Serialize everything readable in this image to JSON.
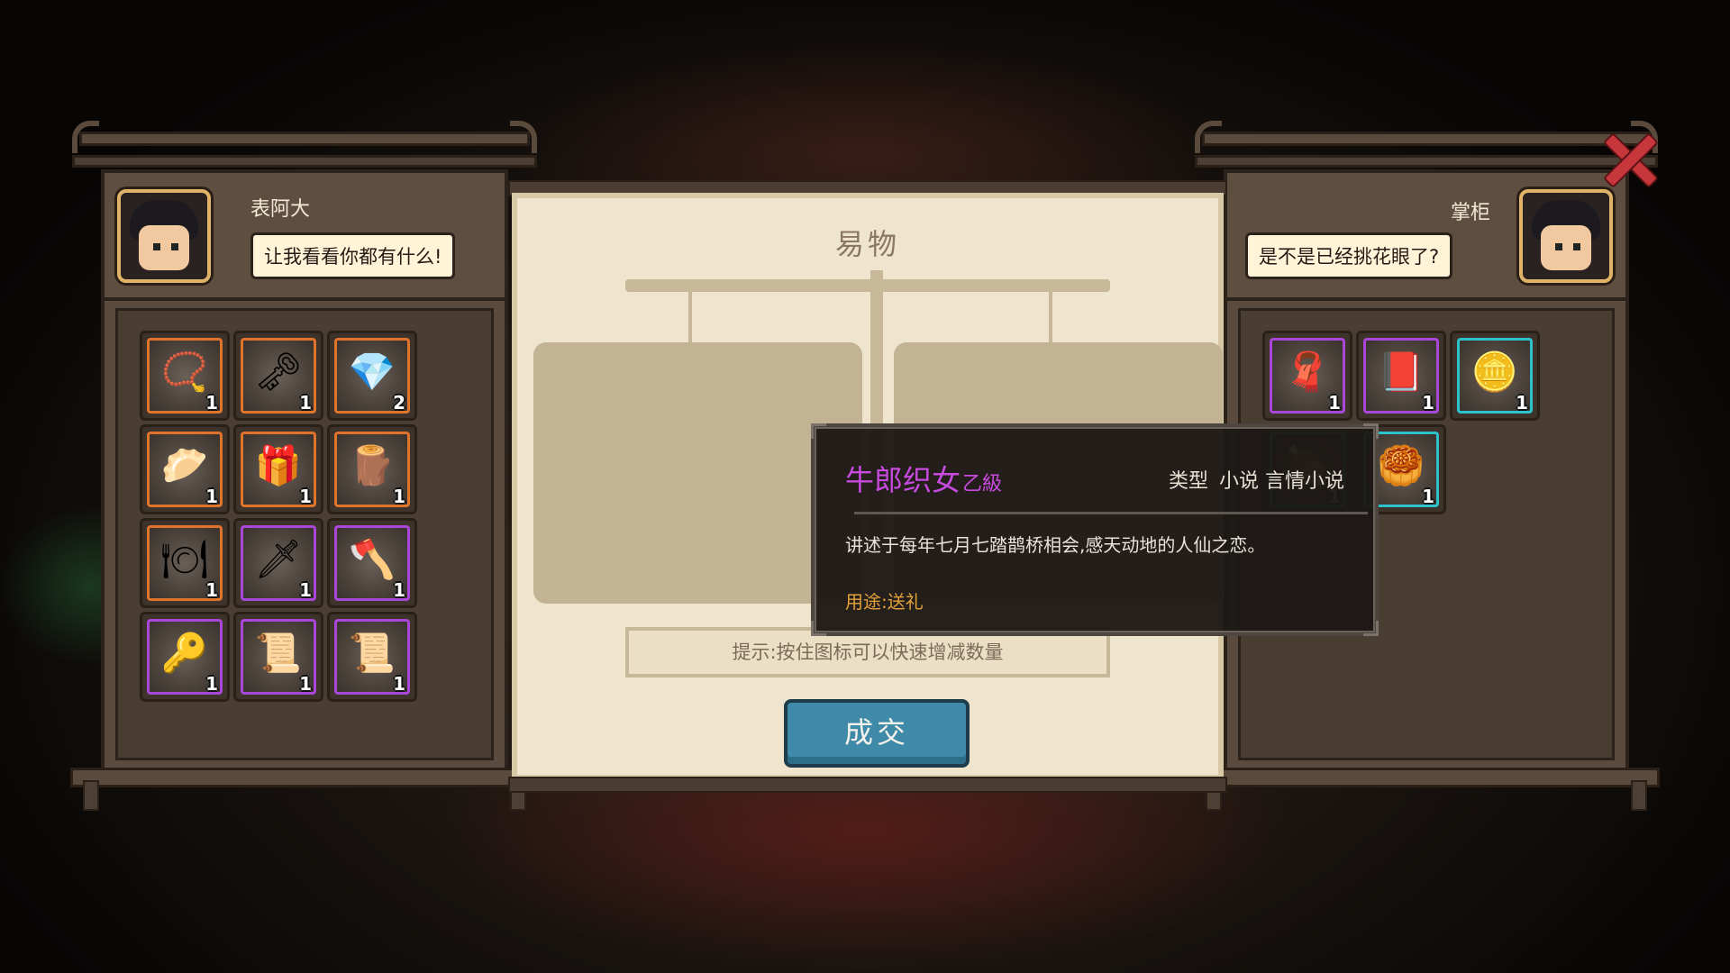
{
  "left_panel": {
    "name": "表阿大",
    "speech": "让我看看你都有什么!",
    "items": [
      {
        "icon": "prayer-beads-icon",
        "glyph": "📿",
        "count": "1",
        "rarity": "orange"
      },
      {
        "icon": "golden-key-icon",
        "glyph": "🗝",
        "count": "1",
        "rarity": "orange"
      },
      {
        "icon": "pink-crystal-icon",
        "glyph": "💎",
        "count": "2",
        "rarity": "orange"
      },
      {
        "icon": "dumpling-plate-icon",
        "glyph": "🥟",
        "count": "1",
        "rarity": "orange"
      },
      {
        "icon": "jewelry-box-icon",
        "glyph": "🎁",
        "count": "1",
        "rarity": "orange"
      },
      {
        "icon": "dark-branch-icon",
        "glyph": "🪵",
        "count": "1",
        "rarity": "orange"
      },
      {
        "icon": "porcelain-dish-icon",
        "glyph": "🍽",
        "count": "1",
        "rarity": "orange"
      },
      {
        "icon": "sword-icon",
        "glyph": "🗡",
        "count": "1",
        "rarity": "purple"
      },
      {
        "icon": "axe-icon",
        "glyph": "🪓",
        "count": "1",
        "rarity": "purple"
      },
      {
        "icon": "silver-key-icon",
        "glyph": "🔑",
        "count": "1",
        "rarity": "purple"
      },
      {
        "icon": "treasure-map-icon",
        "glyph": "📜",
        "count": "1",
        "rarity": "purple"
      },
      {
        "icon": "scroll-map-icon",
        "glyph": "📜",
        "count": "1",
        "rarity": "purple"
      }
    ]
  },
  "right_panel": {
    "name": "掌柜",
    "speech": "是不是已经挑花眼了?",
    "items": [
      {
        "icon": "pink-cloth-icon",
        "glyph": "🧣",
        "count": "1",
        "rarity": "purple"
      },
      {
        "icon": "book-icon",
        "glyph": "📕",
        "count": "1",
        "rarity": "purple"
      },
      {
        "icon": "gold-nuggets-icon",
        "glyph": "🪙",
        "count": "1",
        "rarity": "cyan"
      },
      {
        "icon": "meat-bowl-icon",
        "glyph": "🍖",
        "count": "1",
        "rarity": "cyan"
      },
      {
        "icon": "jade-plate-icon",
        "glyph": "🥮",
        "count": "1",
        "rarity": "cyan"
      }
    ]
  },
  "center": {
    "title": "易物",
    "hint": "提示:按住图标可以快速增减数量",
    "deal_button": "成交"
  },
  "tooltip": {
    "name": "牛郎织女",
    "grade": "乙級",
    "type_label": "类型",
    "type_value": "小说 言情小说",
    "description": "讲述于每年七月七踏鹊桥相会,感天动地的人仙之恋。",
    "usage": "用途:送礼"
  },
  "colors": {
    "rarity_orange": "#e0742a",
    "rarity_purple": "#a948d8",
    "rarity_cyan": "#2bc2cc",
    "tooltip_name": "#c84adf",
    "usage_text": "#e3a23a"
  }
}
